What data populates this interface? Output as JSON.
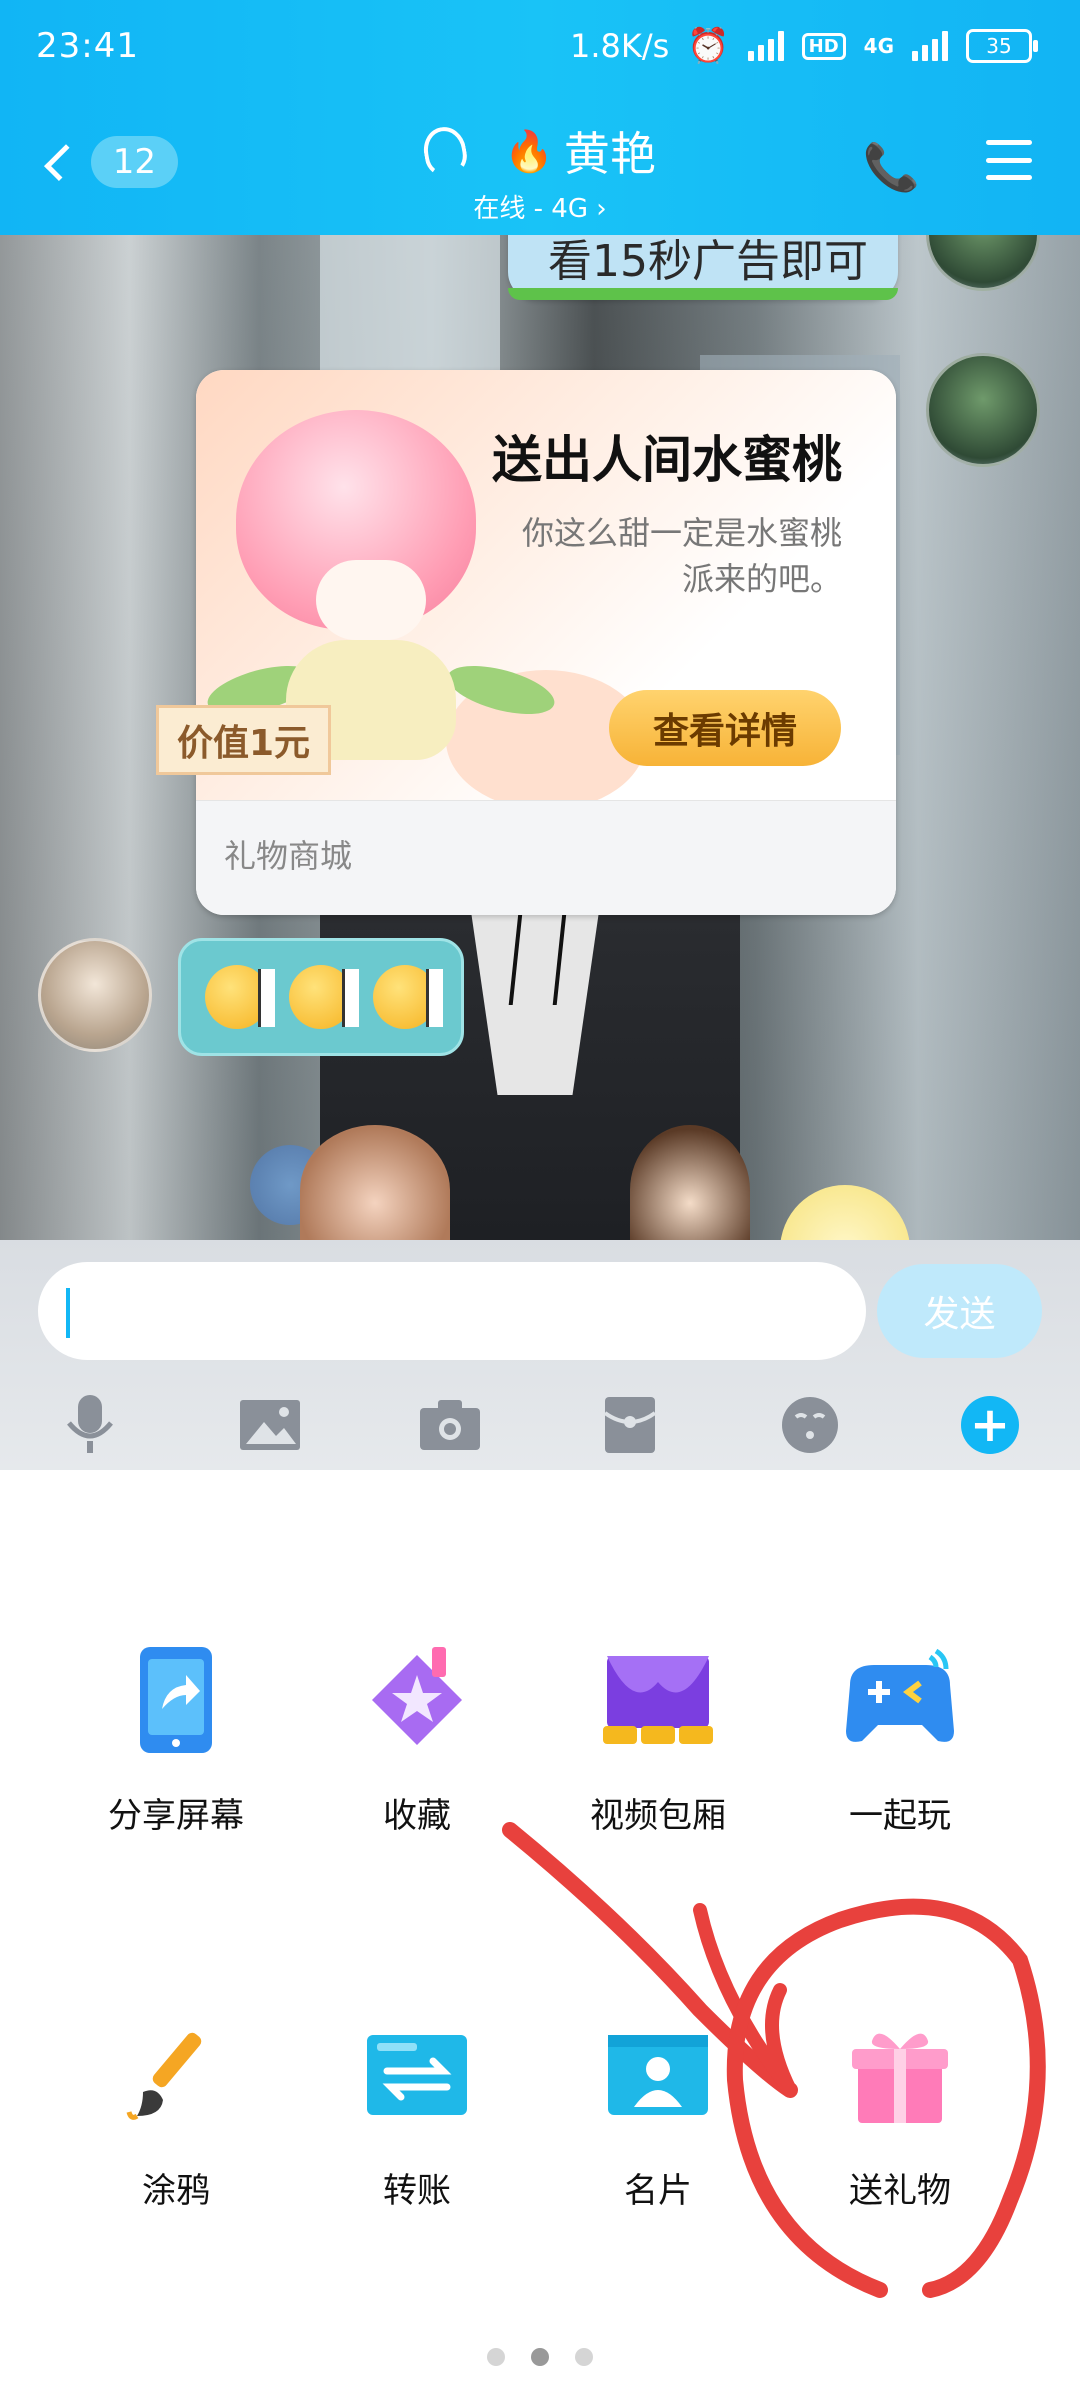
{
  "status_bar": {
    "time": "23:41",
    "net_speed": "1.8K/s",
    "network": "4G",
    "hd": "HD",
    "battery": "35"
  },
  "header": {
    "unread_count": "12",
    "contact_name": "黄艳",
    "contact_status": "在线 - 4G"
  },
  "chat": {
    "prev_bubble_text": "看15秒广告即可",
    "gift_card": {
      "title": "送出人间水蜜桃",
      "description": "你这么甜一定是水蜜桃派来的吧。",
      "price": "价值1元",
      "button": "查看详情",
      "footer": "礼物商城"
    }
  },
  "input": {
    "value": "",
    "send_label": "发送"
  },
  "toolbar_icons": [
    "microphone-icon",
    "image-icon",
    "camera-icon",
    "red-packet-icon",
    "emoji-icon",
    "plus-icon"
  ],
  "panel": {
    "items": [
      {
        "label": "分享屏幕",
        "icon": "share-screen-icon"
      },
      {
        "label": "收藏",
        "icon": "favorites-icon"
      },
      {
        "label": "视频包厢",
        "icon": "video-room-icon"
      },
      {
        "label": "一起玩",
        "icon": "play-together-icon"
      },
      {
        "label": "涂鸦",
        "icon": "doodle-brush-icon"
      },
      {
        "label": "转账",
        "icon": "transfer-icon"
      },
      {
        "label": "名片",
        "icon": "business-card-icon"
      },
      {
        "label": "送礼物",
        "icon": "gift-icon"
      }
    ],
    "page_count": 3,
    "active_page": 2
  },
  "colors": {
    "header": "#12b7f5",
    "annotation": "#e8413d"
  }
}
